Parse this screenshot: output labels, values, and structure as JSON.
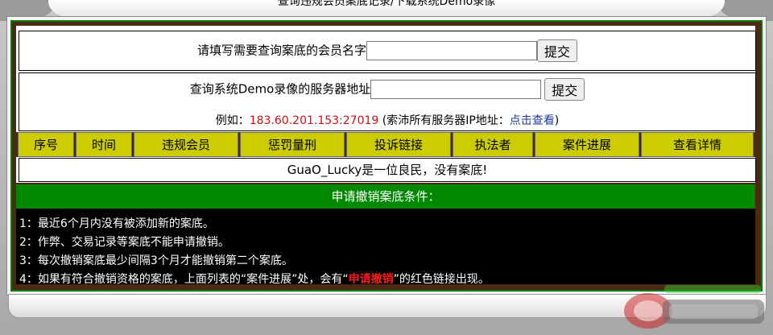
{
  "window": {
    "title": "查询违规会员案底记录/下载系统Demo录像"
  },
  "query_form": {
    "label": "请填写需要查询案底的会员名字",
    "input_value": "",
    "submit_label": "提交"
  },
  "server_form": {
    "label": "查询系统Demo录像的服务器地址",
    "input_value": "",
    "submit_label": "提交",
    "example_prefix": "例如：",
    "example_value": "183.60.201.153:27019",
    "example_note_open": " (索沛所有服务器IP地址：",
    "example_link": "点击查看",
    "example_note_close": ")"
  },
  "table": {
    "headers": [
      "序号",
      "时间",
      "违规会员",
      "惩罚量刑",
      "投诉链接",
      "执法者",
      "案件进展",
      "查看详情"
    ]
  },
  "result_message": "GuaO_Lucky是一位良民，没有案底!",
  "revoke": {
    "title": "申请撤销案底条件：",
    "items": [
      "1：最近6个月内没有被添加新的案底。",
      "2：作弊、交易记录等案底不能申请撤销。",
      "3：每次撤销案底最少间隔3个月才能撤销第二个案底。"
    ],
    "item4_prefix": "4：如果有符合撤销资格的案底，上面列表的“案件进展”处，会有“",
    "item4_highlight": "申请撤销",
    "item4_suffix": "”的红色链接出现。"
  },
  "colors": {
    "header_bg": "#cccc00",
    "green_bar": "#008800",
    "frame_brown": "#4a2a12",
    "highlight_red": "#ff1a1a",
    "example_red": "#d01010"
  }
}
